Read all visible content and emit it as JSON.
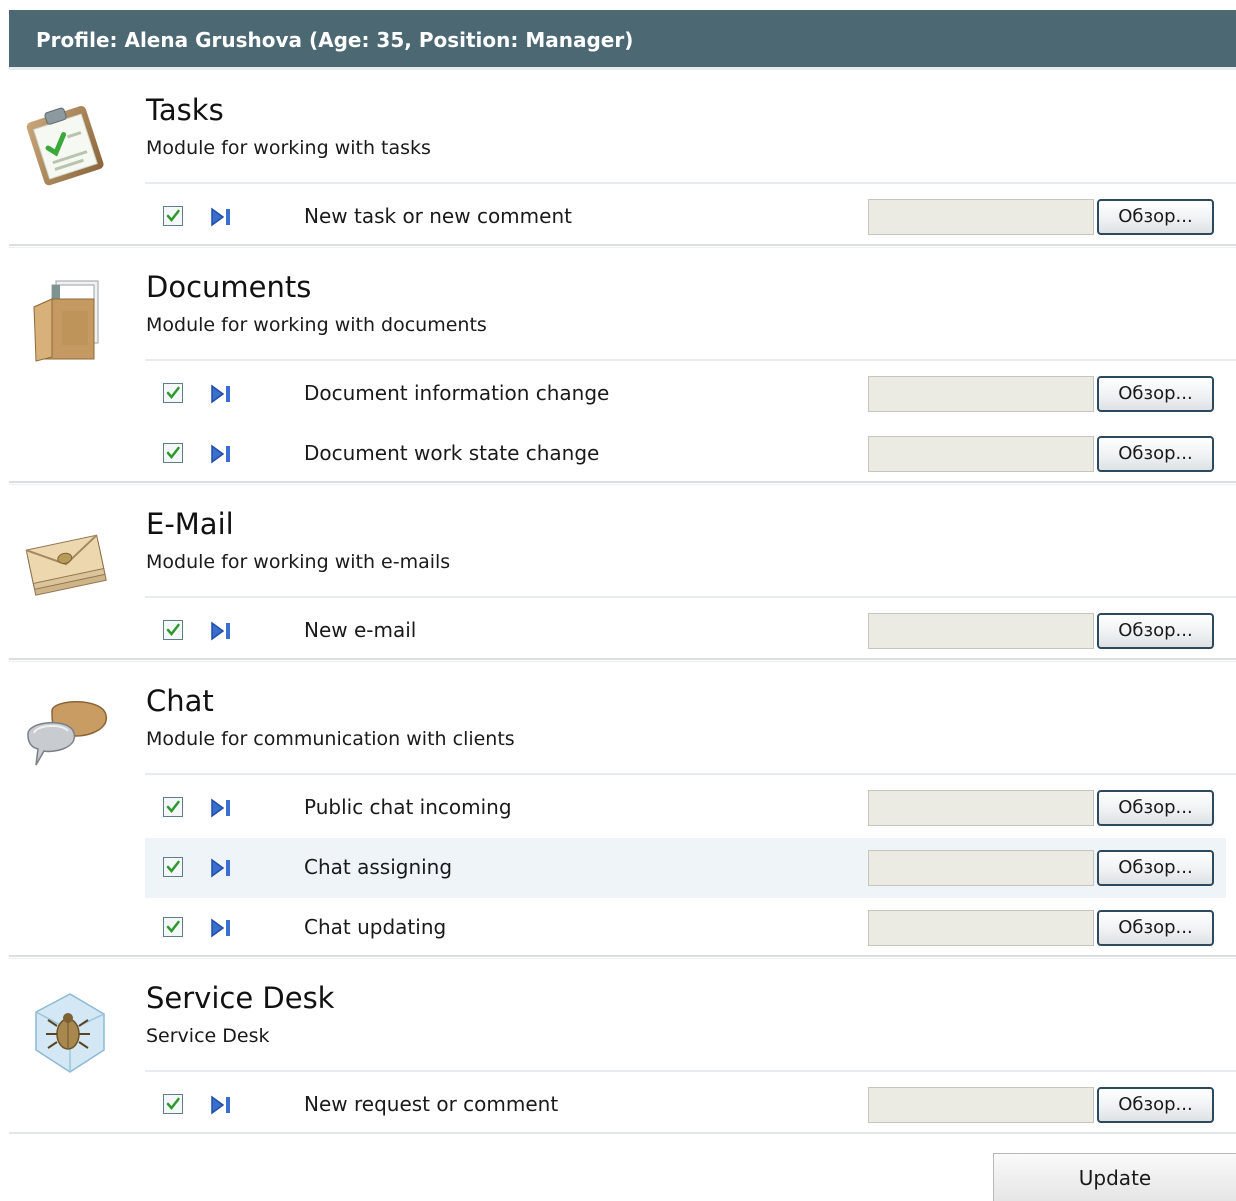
{
  "header": {
    "title": "Profile: Alena Grushova (Age: 35, Position: Manager)"
  },
  "browse_label": "Обзор...",
  "modules": [
    {
      "icon": "tasks-clipboard-icon",
      "title": "Tasks",
      "subtitle": "Module for working with tasks",
      "events": [
        {
          "label": "New task or new comment",
          "checked": true,
          "file": ""
        }
      ]
    },
    {
      "icon": "documents-folder-icon",
      "title": "Documents",
      "subtitle": "Module for working with documents",
      "events": [
        {
          "label": "Document information change",
          "checked": true,
          "file": ""
        },
        {
          "label": "Document work state change",
          "checked": true,
          "file": ""
        }
      ]
    },
    {
      "icon": "email-envelope-icon",
      "title": "E-Mail",
      "subtitle": "Module for working with e-mails",
      "events": [
        {
          "label": "New e-mail",
          "checked": true,
          "file": ""
        }
      ]
    },
    {
      "icon": "chat-bubbles-icon",
      "title": "Chat",
      "subtitle": "Module for communication with clients",
      "events": [
        {
          "label": "Public chat incoming",
          "checked": true,
          "file": ""
        },
        {
          "label": "Chat assigning",
          "checked": true,
          "file": ""
        },
        {
          "label": "Chat updating",
          "checked": true,
          "file": ""
        }
      ]
    },
    {
      "icon": "service-desk-bug-icon",
      "title": "Service Desk",
      "subtitle": "Service Desk",
      "events": [
        {
          "label": "New request or comment",
          "checked": true,
          "file": ""
        }
      ]
    }
  ],
  "footer": {
    "update_label": "Update"
  },
  "colors": {
    "header_bg": "#4c6872",
    "row_highlight": "#eef4f7",
    "checkmark": "#2e9a2e",
    "play_icon": "#3a6fd0"
  }
}
